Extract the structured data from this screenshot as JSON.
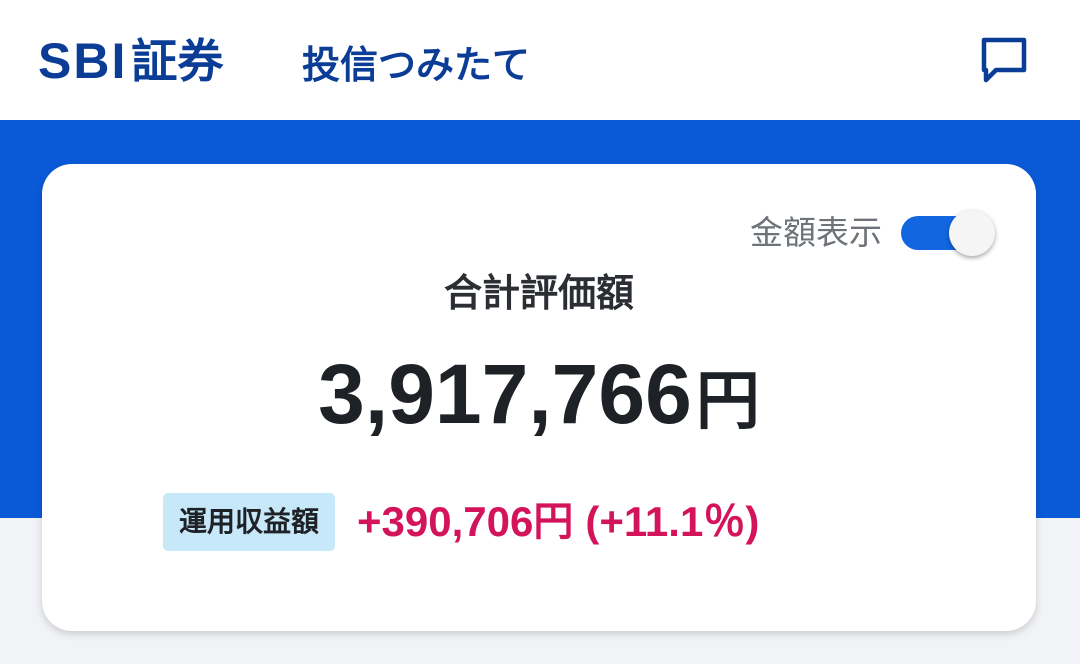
{
  "header": {
    "brand_latin": "SBI",
    "brand_jp": "証券",
    "service": "投信つみたて",
    "chat_icon": "chat-bubble-icon"
  },
  "colors": {
    "brand_navy": "#0b3c96",
    "accent_blue": "#0a5ad8",
    "toggle_on": "#1266e0",
    "profit_red": "#d4145a",
    "badge_bg": "#c7e8f8"
  },
  "summary": {
    "show_amount_label": "金額表示",
    "show_amount_on": true,
    "total_label": "合計評価額",
    "total_value": "3,917,766",
    "currency": "円",
    "profit_label": "運用収益額",
    "profit_value": "+390,706",
    "profit_percent": "(+11.1％)"
  }
}
